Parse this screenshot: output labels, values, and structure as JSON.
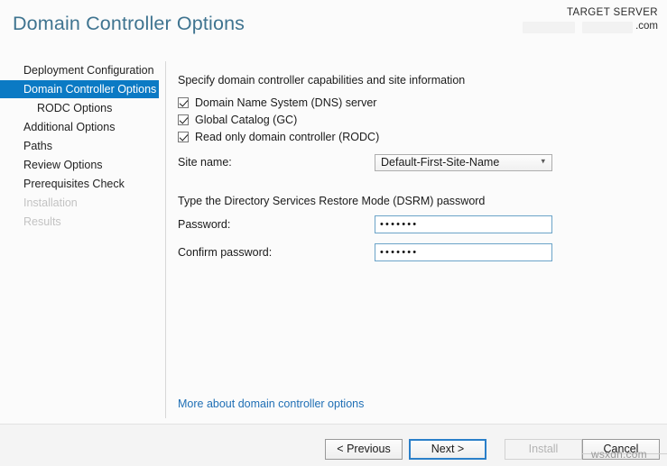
{
  "header": {
    "title": "Domain Controller Options",
    "target_server_label": "TARGET SERVER",
    "target_server_name": ".com"
  },
  "sidebar": {
    "items": [
      {
        "label": "Deployment Configuration",
        "state": "normal",
        "indented": false
      },
      {
        "label": "Domain Controller Options",
        "state": "selected",
        "indented": false
      },
      {
        "label": "RODC Options",
        "state": "normal",
        "indented": true
      },
      {
        "label": "Additional Options",
        "state": "normal",
        "indented": false
      },
      {
        "label": "Paths",
        "state": "normal",
        "indented": false
      },
      {
        "label": "Review Options",
        "state": "normal",
        "indented": false
      },
      {
        "label": "Prerequisites Check",
        "state": "normal",
        "indented": false
      },
      {
        "label": "Installation",
        "state": "disabled",
        "indented": false
      },
      {
        "label": "Results",
        "state": "disabled",
        "indented": false
      }
    ]
  },
  "main": {
    "capabilities_heading": "Specify domain controller capabilities and site information",
    "checkboxes": [
      {
        "label": "Domain Name System (DNS) server",
        "checked": true
      },
      {
        "label": "Global Catalog (GC)",
        "checked": true
      },
      {
        "label": "Read only domain controller (RODC)",
        "checked": true
      }
    ],
    "site_name_label": "Site name:",
    "site_name_value": "Default-First-Site-Name",
    "site_name_arrow": "chevron-down-icon",
    "dsrm_heading": "Type the Directory Services Restore Mode (DSRM) password",
    "password_label": "Password:",
    "password_value": "•••••••",
    "confirm_password_label": "Confirm password:",
    "confirm_password_value": "•••••••",
    "more_link": "More about domain controller options"
  },
  "footer": {
    "previous_label": "< Previous",
    "next_label": "Next >",
    "install_label": "Install",
    "cancel_label": "Cancel"
  },
  "watermark": {
    "text": "wsxdn.com"
  },
  "colors": {
    "accent_blue": "#0b7ac4",
    "title_blue": "#3f7490",
    "link_blue": "#1f6fb5",
    "focus_border": "#2a7fc9",
    "input_border": "#6ba3c8"
  }
}
